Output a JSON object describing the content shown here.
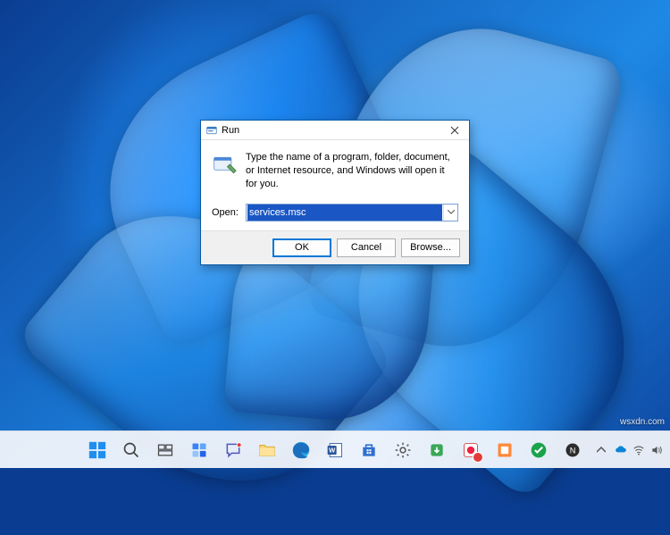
{
  "run_dialog": {
    "title": "Run",
    "description": "Type the name of a program, folder, document, or Internet resource, and Windows will open it for you.",
    "open_label": "Open:",
    "input_value": "services.msc",
    "buttons": {
      "ok": "OK",
      "cancel": "Cancel",
      "browse": "Browse..."
    }
  },
  "taskbar": {
    "items": [
      "start",
      "search",
      "task-view",
      "widgets",
      "chat",
      "file-explorer",
      "edge",
      "word",
      "store",
      "settings",
      "downloads",
      "app1",
      "app2",
      "app3",
      "app4",
      "app5"
    ]
  },
  "watermark": "wsxdn.com"
}
